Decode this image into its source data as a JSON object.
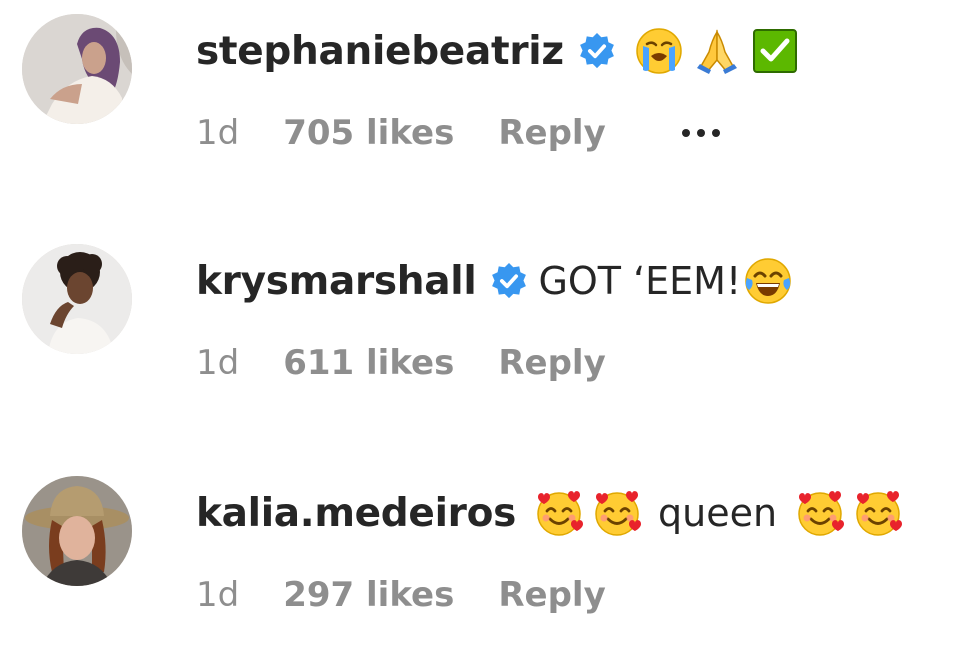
{
  "comments": [
    {
      "username": "stephaniebeatriz",
      "verified": true,
      "text": "",
      "emojis_before": [
        "loudly-crying-face",
        "folded-hands",
        "check-mark-button"
      ],
      "emojis_after": [],
      "time": "1d",
      "likes": "705 likes",
      "reply": "Reply",
      "has_more_menu": true
    },
    {
      "username": "krysmarshall",
      "verified": true,
      "text": "GOT ‘EEM!",
      "emojis_after": [
        "face-with-tears-of-joy"
      ],
      "time": "1d",
      "likes": "611 likes",
      "reply": "Reply"
    },
    {
      "username": "kalia.medeiros",
      "verified": false,
      "text": "queen",
      "emojis_before": [
        "smiling-face-with-hearts",
        "smiling-face-with-hearts"
      ],
      "emojis_after": [
        "smiling-face-with-hearts",
        "smiling-face-with-hearts"
      ],
      "time": "1d",
      "likes": "297 likes",
      "reply": "Reply"
    }
  ],
  "colors": {
    "text": "#262626",
    "meta": "#8e8e8e",
    "verified": "#3897f0"
  }
}
